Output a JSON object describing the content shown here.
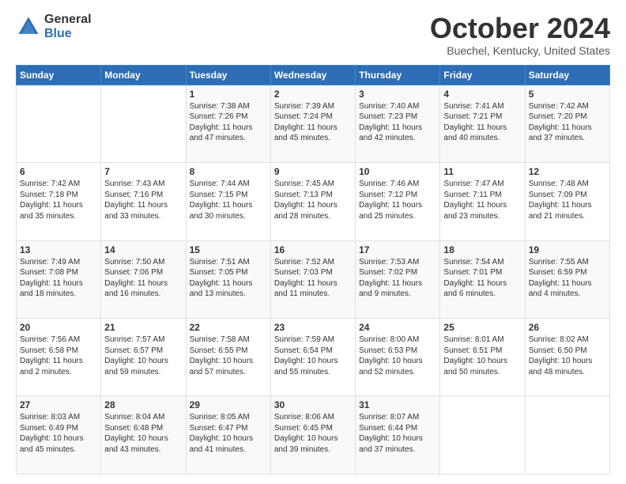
{
  "header": {
    "logo_general": "General",
    "logo_blue": "Blue",
    "month_title": "October 2024",
    "location": "Buechel, Kentucky, United States"
  },
  "days_of_week": [
    "Sunday",
    "Monday",
    "Tuesday",
    "Wednesday",
    "Thursday",
    "Friday",
    "Saturday"
  ],
  "weeks": [
    [
      {
        "day": "",
        "sunrise": "",
        "sunset": "",
        "daylight": ""
      },
      {
        "day": "",
        "sunrise": "",
        "sunset": "",
        "daylight": ""
      },
      {
        "day": "1",
        "sunrise": "Sunrise: 7:38 AM",
        "sunset": "Sunset: 7:26 PM",
        "daylight": "Daylight: 11 hours and 47 minutes."
      },
      {
        "day": "2",
        "sunrise": "Sunrise: 7:39 AM",
        "sunset": "Sunset: 7:24 PM",
        "daylight": "Daylight: 11 hours and 45 minutes."
      },
      {
        "day": "3",
        "sunrise": "Sunrise: 7:40 AM",
        "sunset": "Sunset: 7:23 PM",
        "daylight": "Daylight: 11 hours and 42 minutes."
      },
      {
        "day": "4",
        "sunrise": "Sunrise: 7:41 AM",
        "sunset": "Sunset: 7:21 PM",
        "daylight": "Daylight: 11 hours and 40 minutes."
      },
      {
        "day": "5",
        "sunrise": "Sunrise: 7:42 AM",
        "sunset": "Sunset: 7:20 PM",
        "daylight": "Daylight: 11 hours and 37 minutes."
      }
    ],
    [
      {
        "day": "6",
        "sunrise": "Sunrise: 7:42 AM",
        "sunset": "Sunset: 7:18 PM",
        "daylight": "Daylight: 11 hours and 35 minutes."
      },
      {
        "day": "7",
        "sunrise": "Sunrise: 7:43 AM",
        "sunset": "Sunset: 7:16 PM",
        "daylight": "Daylight: 11 hours and 33 minutes."
      },
      {
        "day": "8",
        "sunrise": "Sunrise: 7:44 AM",
        "sunset": "Sunset: 7:15 PM",
        "daylight": "Daylight: 11 hours and 30 minutes."
      },
      {
        "day": "9",
        "sunrise": "Sunrise: 7:45 AM",
        "sunset": "Sunset: 7:13 PM",
        "daylight": "Daylight: 11 hours and 28 minutes."
      },
      {
        "day": "10",
        "sunrise": "Sunrise: 7:46 AM",
        "sunset": "Sunset: 7:12 PM",
        "daylight": "Daylight: 11 hours and 25 minutes."
      },
      {
        "day": "11",
        "sunrise": "Sunrise: 7:47 AM",
        "sunset": "Sunset: 7:11 PM",
        "daylight": "Daylight: 11 hours and 23 minutes."
      },
      {
        "day": "12",
        "sunrise": "Sunrise: 7:48 AM",
        "sunset": "Sunset: 7:09 PM",
        "daylight": "Daylight: 11 hours and 21 minutes."
      }
    ],
    [
      {
        "day": "13",
        "sunrise": "Sunrise: 7:49 AM",
        "sunset": "Sunset: 7:08 PM",
        "daylight": "Daylight: 11 hours and 18 minutes."
      },
      {
        "day": "14",
        "sunrise": "Sunrise: 7:50 AM",
        "sunset": "Sunset: 7:06 PM",
        "daylight": "Daylight: 11 hours and 16 minutes."
      },
      {
        "day": "15",
        "sunrise": "Sunrise: 7:51 AM",
        "sunset": "Sunset: 7:05 PM",
        "daylight": "Daylight: 11 hours and 13 minutes."
      },
      {
        "day": "16",
        "sunrise": "Sunrise: 7:52 AM",
        "sunset": "Sunset: 7:03 PM",
        "daylight": "Daylight: 11 hours and 11 minutes."
      },
      {
        "day": "17",
        "sunrise": "Sunrise: 7:53 AM",
        "sunset": "Sunset: 7:02 PM",
        "daylight": "Daylight: 11 hours and 9 minutes."
      },
      {
        "day": "18",
        "sunrise": "Sunrise: 7:54 AM",
        "sunset": "Sunset: 7:01 PM",
        "daylight": "Daylight: 11 hours and 6 minutes."
      },
      {
        "day": "19",
        "sunrise": "Sunrise: 7:55 AM",
        "sunset": "Sunset: 6:59 PM",
        "daylight": "Daylight: 11 hours and 4 minutes."
      }
    ],
    [
      {
        "day": "20",
        "sunrise": "Sunrise: 7:56 AM",
        "sunset": "Sunset: 6:58 PM",
        "daylight": "Daylight: 11 hours and 2 minutes."
      },
      {
        "day": "21",
        "sunrise": "Sunrise: 7:57 AM",
        "sunset": "Sunset: 6:57 PM",
        "daylight": "Daylight: 10 hours and 59 minutes."
      },
      {
        "day": "22",
        "sunrise": "Sunrise: 7:58 AM",
        "sunset": "Sunset: 6:55 PM",
        "daylight": "Daylight: 10 hours and 57 minutes."
      },
      {
        "day": "23",
        "sunrise": "Sunrise: 7:59 AM",
        "sunset": "Sunset: 6:54 PM",
        "daylight": "Daylight: 10 hours and 55 minutes."
      },
      {
        "day": "24",
        "sunrise": "Sunrise: 8:00 AM",
        "sunset": "Sunset: 6:53 PM",
        "daylight": "Daylight: 10 hours and 52 minutes."
      },
      {
        "day": "25",
        "sunrise": "Sunrise: 8:01 AM",
        "sunset": "Sunset: 6:51 PM",
        "daylight": "Daylight: 10 hours and 50 minutes."
      },
      {
        "day": "26",
        "sunrise": "Sunrise: 8:02 AM",
        "sunset": "Sunset: 6:50 PM",
        "daylight": "Daylight: 10 hours and 48 minutes."
      }
    ],
    [
      {
        "day": "27",
        "sunrise": "Sunrise: 8:03 AM",
        "sunset": "Sunset: 6:49 PM",
        "daylight": "Daylight: 10 hours and 45 minutes."
      },
      {
        "day": "28",
        "sunrise": "Sunrise: 8:04 AM",
        "sunset": "Sunset: 6:48 PM",
        "daylight": "Daylight: 10 hours and 43 minutes."
      },
      {
        "day": "29",
        "sunrise": "Sunrise: 8:05 AM",
        "sunset": "Sunset: 6:47 PM",
        "daylight": "Daylight: 10 hours and 41 minutes."
      },
      {
        "day": "30",
        "sunrise": "Sunrise: 8:06 AM",
        "sunset": "Sunset: 6:45 PM",
        "daylight": "Daylight: 10 hours and 39 minutes."
      },
      {
        "day": "31",
        "sunrise": "Sunrise: 8:07 AM",
        "sunset": "Sunset: 6:44 PM",
        "daylight": "Daylight: 10 hours and 37 minutes."
      },
      {
        "day": "",
        "sunrise": "",
        "sunset": "",
        "daylight": ""
      },
      {
        "day": "",
        "sunrise": "",
        "sunset": "",
        "daylight": ""
      }
    ]
  ]
}
